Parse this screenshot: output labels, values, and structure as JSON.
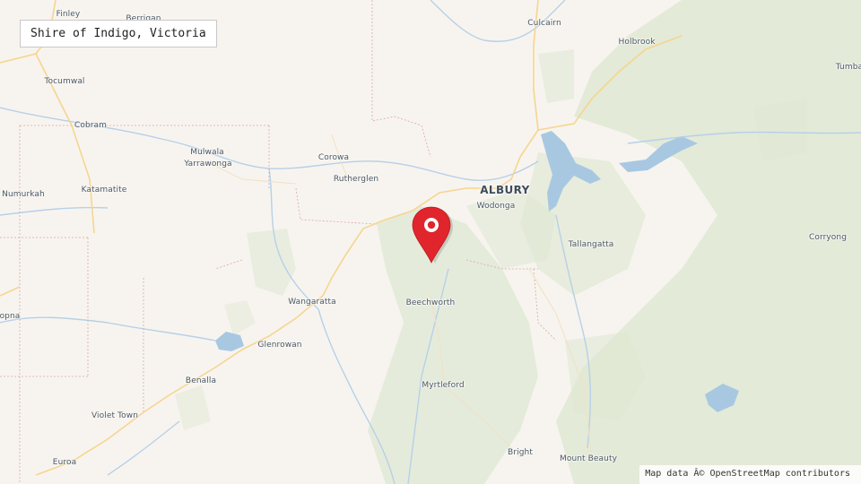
{
  "title": "Shire of Indigo, Victoria",
  "attribution": "Map data Â© OpenStreetMap contributors",
  "marker_icon": "map-pin-icon",
  "colors": {
    "background": "#f7f4ef",
    "forest": "#dfe8d4",
    "water": "#a8c8e2",
    "river": "#b7d0e8",
    "road": "#f6d58e",
    "border": "#d9a7a7",
    "marker": "#e0262c"
  },
  "places": [
    {
      "name": "Finley",
      "type": "town"
    },
    {
      "name": "Berrigan",
      "type": "town"
    },
    {
      "name": "Culcairn",
      "type": "town"
    },
    {
      "name": "Holbrook",
      "type": "town"
    },
    {
      "name": "Tumba",
      "type": "town"
    },
    {
      "name": "Tocumwal",
      "type": "town"
    },
    {
      "name": "Cobram",
      "type": "town"
    },
    {
      "name": "Mulwala",
      "type": "town"
    },
    {
      "name": "Yarrawonga",
      "type": "town"
    },
    {
      "name": "Corowa",
      "type": "town"
    },
    {
      "name": "Rutherglen",
      "type": "town"
    },
    {
      "name": "ALBURY",
      "type": "city"
    },
    {
      "name": "Wodonga",
      "type": "town"
    },
    {
      "name": "Numurkah",
      "type": "town"
    },
    {
      "name": "Katamatite",
      "type": "town"
    },
    {
      "name": "Tallangatta",
      "type": "town"
    },
    {
      "name": "Corryong",
      "type": "town"
    },
    {
      "name": "Wangaratta",
      "type": "town"
    },
    {
      "name": "Beechworth",
      "type": "town"
    },
    {
      "name": "opna",
      "type": "town"
    },
    {
      "name": "Glenrowan",
      "type": "town"
    },
    {
      "name": "Benalla",
      "type": "town"
    },
    {
      "name": "Myrtleford",
      "type": "town"
    },
    {
      "name": "Violet Town",
      "type": "town"
    },
    {
      "name": "Euroa",
      "type": "town"
    },
    {
      "name": "Bright",
      "type": "town"
    },
    {
      "name": "Mount Beauty",
      "type": "town"
    }
  ]
}
